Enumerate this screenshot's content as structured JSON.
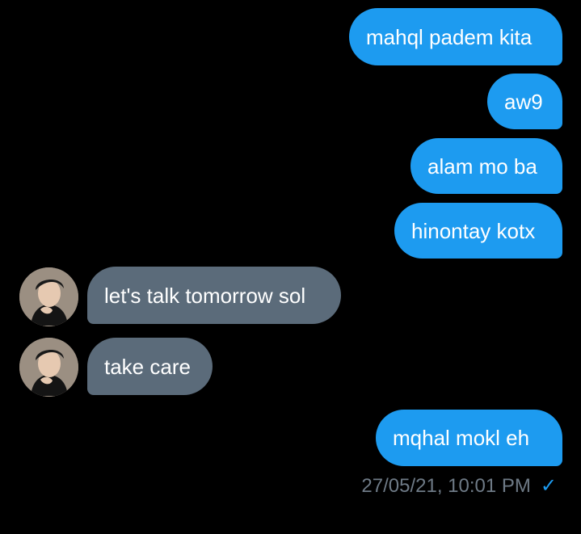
{
  "thread": {
    "messages": [
      {
        "from": "me",
        "text": "mahql padem kita"
      },
      {
        "from": "me",
        "text": "aw9"
      },
      {
        "from": "me",
        "text": "alam mo ba"
      },
      {
        "from": "me",
        "text": "hinontay kotx"
      },
      {
        "from": "them",
        "text": "let's talk tomorrow sol"
      },
      {
        "from": "them",
        "text": "take care"
      },
      {
        "from": "me",
        "text": "mqhal mokl eh"
      }
    ],
    "timestamp": "27/05/21, 10:01 PM",
    "read_receipt_icon": "checkmark-icon"
  },
  "colors": {
    "background": "#000000",
    "sent_bubble": "#1d9bf0",
    "received_bubble": "#5b6b7a",
    "meta_text": "#6e7a86"
  }
}
